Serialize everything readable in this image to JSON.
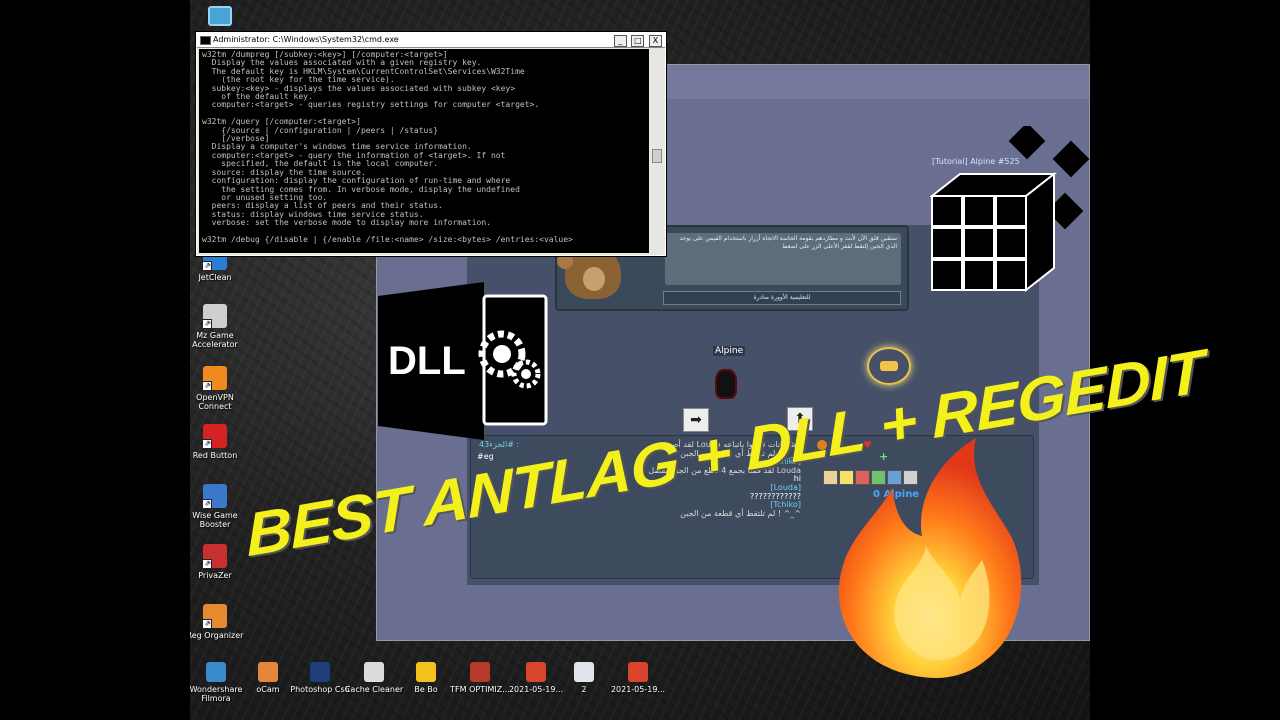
{
  "cmd": {
    "title": "Administrator: C:\\Windows\\System32\\cmd.exe",
    "buttons": [
      "_",
      "□",
      "X"
    ],
    "lines": "w32tm /dumpreg [/subkey:<key>] [/computer:<target>]\n  Display the values associated with a given registry key.\n  The default key is HKLM\\System\\CurrentControlSet\\Services\\W32Time\n    (the root key for the time service).\n  subkey:<key> - displays the values associated with subkey <key>\n    of the default key.\n  computer:<target> - queries registry settings for computer <target>.\n\nw32tm /query [/computer:<target>]\n    {/source | /configuration | /peers | /status}\n    [/verbose]\n  Display a computer's windows time service information.\n  computer:<target> - query the information of <target>. If not\n    specified, the default is the local computer.\n  source: display the time source.\n  configuration: display the configuration of run-time and where\n    the setting comes from. In verbose mode, display the undefined\n    or unused setting too.\n  peers: display a list of peers and their status.\n  status: display windows time service status.\n  verbose: set the verbose mode to display more information.\n\nw32tm /debug {/disable | {/enable /file:<name> /size:<bytes> /entries:<value>"
  },
  "desktop_icons": [
    {
      "label": "JetClean",
      "color": "#2a7fd4"
    },
    {
      "label": "Mz Game Accelerator",
      "color": "#cfcfcf"
    },
    {
      "label": "OpenVPN Connect",
      "color": "#f08a1c"
    },
    {
      "label": "Red Button",
      "color": "#d52222"
    },
    {
      "label": "Wise Game Booster",
      "color": "#3c78c8"
    },
    {
      "label": "PrivaZer",
      "color": "#c83030"
    },
    {
      "label": "Reg Organizer",
      "color": "#e68a2e"
    }
  ],
  "taskbar_icons": [
    {
      "label": "Wondershare Filmora",
      "color": "#3a8ad0"
    },
    {
      "label": "oCam",
      "color": "#e6863a"
    },
    {
      "label": "Photoshop Cs6",
      "color": "#1c3f7a"
    },
    {
      "label": "Cache Cleaner",
      "color": "#dcdcdc"
    },
    {
      "label": "Be Bo",
      "color": "#f2c21a"
    },
    {
      "label": "TFM OPTIMIZ...",
      "color": "#b8382a"
    },
    {
      "label": "2021-05-19...",
      "color": "#d8452c"
    },
    {
      "label": "2",
      "color": "#e0e4ea"
    },
    {
      "label": "2021-05-19...",
      "color": "#d8452c"
    }
  ],
  "game": {
    "tutorial_tag": "[Tutorial] Alpine #525",
    "player_name": "Alpine",
    "dialog_text": "ستقين قلق الآن لأنت و مطاردهم بقومة الحاسة الاتجاه أزرار باستخدام القيمن على يوجد الذي الجبن إلتقط لقفز الأعلى الزر على اضغط",
    "dialog_button": "للتعليمية الأوورة منادرة",
    "arrow_right": "➡",
    "arrow_up": "⬆",
    "chat_header": "الجزء43# :",
    "chat_cmd": "#eg",
    "chat_lines": [
      "لقد أصبح Louda الشامانات قوموا باتباعه",
      "لم تلتقط أي قطعة من الجبن ! ^_^",
      "[Tchiko]",
      "لقد قمنا بجمع 4 قطع من الجبن بفضل Louda",
      "hi",
      "[Louda]",
      "????????????",
      "[Tchiko]",
      "لم تلتقط أي قطعة من الجبن ! ^_^"
    ],
    "score_label": "0 Alpine"
  },
  "headline": "BEST ANTLAG + DLL + REGEDIT",
  "dll_label": "DLL"
}
